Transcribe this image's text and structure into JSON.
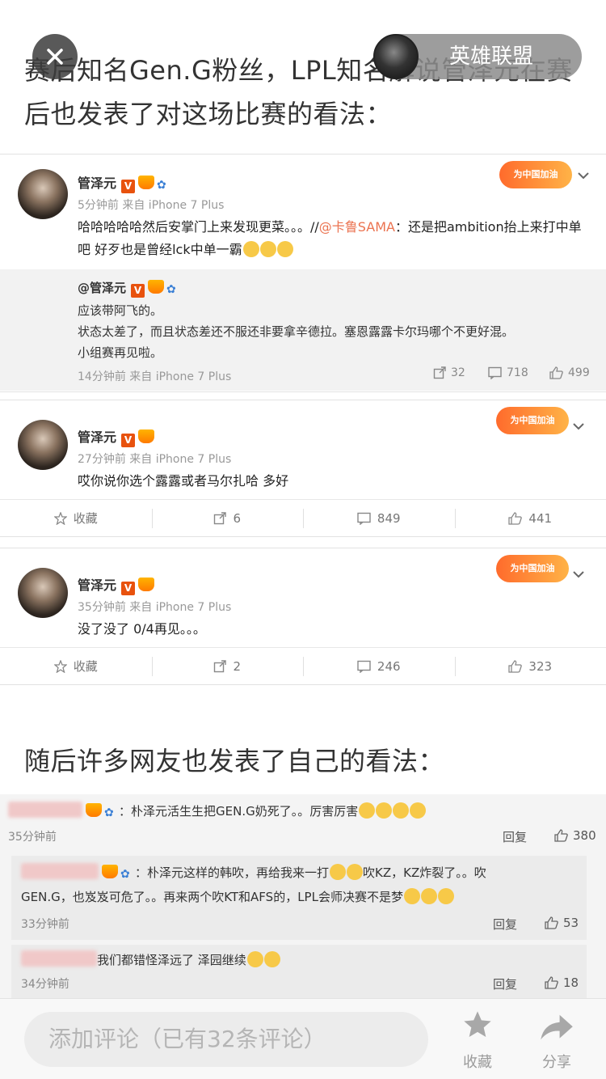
{
  "article": {
    "para1": "赛后知名Gen.G粉丝，LPL知名解说管泽元在赛后也发表了对这场比赛的看法：",
    "para2": "随后许多网友也发表了自己的看法："
  },
  "topbar": {
    "channel_name": "英雄联盟"
  },
  "posts": [
    {
      "user": "管泽元",
      "meta": "5分钟前 来自 iPhone 7 Plus",
      "text_a": "哈哈哈哈哈然后安掌门上来发现更菜。。。//",
      "mention": "@卡鲁SAMA",
      "text_b": "：还是把ambition抬上来打中单吧   好歹也是曾经lck中单一霸",
      "cheer": "为中国加油",
      "quote": {
        "user": "@管泽元",
        "line1": "应该带阿飞的。",
        "line2": "状态太差了，而且状态差还不服还非要拿辛德拉。塞恩露露卡尔玛哪个不更好混。",
        "line3": "小组赛再见啦。",
        "meta": "14分钟前 来自 iPhone 7 Plus",
        "reposts": "32",
        "comments": "718",
        "likes": "499"
      }
    },
    {
      "user": "管泽元",
      "meta": "27分钟前 来自 iPhone 7 Plus",
      "text": "哎你说你选个露露或者马尔扎哈 多好",
      "cheer": "为中国加油",
      "actions": {
        "fav": "收藏",
        "reposts": "6",
        "comments": "849",
        "likes": "441"
      }
    },
    {
      "user": "管泽元",
      "meta": "35分钟前 来自 iPhone 7 Plus",
      "text": "没了没了 0/4再见。。。",
      "cheer": "为中国加油",
      "actions": {
        "fav": "收藏",
        "reposts": "2",
        "comments": "246",
        "likes": "323"
      }
    }
  ],
  "comments": [
    {
      "text": "：朴泽元活生生把GEN.G奶死了。。厉害厉害",
      "time": "35分钟前",
      "reply": "回复",
      "likes": "380"
    },
    {
      "text1": "：朴泽元这样的韩吹，再给我来一打",
      "text1b": "吹KZ，KZ炸裂了。。吹",
      "text2": "GEN.G，也岌岌可危了。。再来两个吹KT和AFS的，LPL会师决赛不是梦",
      "time": "33分钟前",
      "reply": "回复",
      "likes": "53"
    },
    {
      "text": "我们都错怪泽远了 泽园继续",
      "time": "34分钟前",
      "reply": "回复",
      "likes": "18"
    }
  ],
  "bottom": {
    "placeholder": "添加评论（已有32条评论）",
    "fav_label": "收藏",
    "share_label": "分享"
  }
}
